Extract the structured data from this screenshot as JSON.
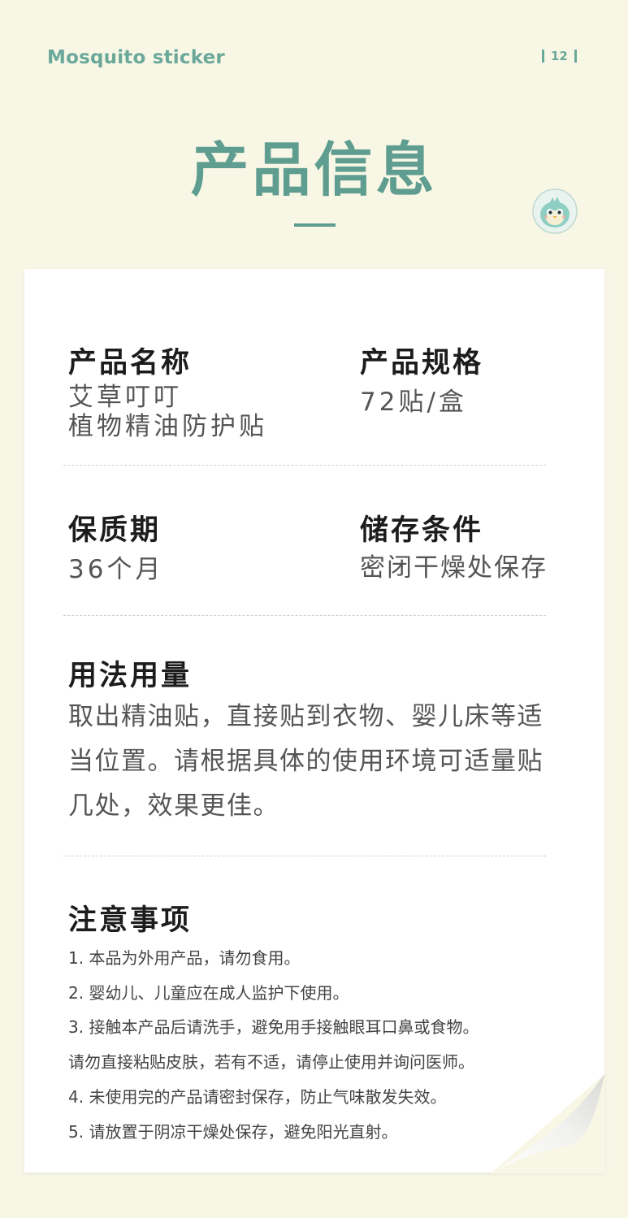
{
  "header": {
    "brand": "Mosquito sticker",
    "page_number": "12"
  },
  "title": "产品信息",
  "fields": {
    "name": {
      "label": "产品名称",
      "value_line1": "艾草叮叮",
      "value_line2": "植物精油防护贴"
    },
    "spec": {
      "label": "产品规格",
      "value": "72贴/盒"
    },
    "shelf_life": {
      "label": "保质期",
      "value": "36个月"
    },
    "storage": {
      "label": "储存条件",
      "value": "密闭干燥处保存"
    },
    "usage": {
      "label": "用法用量",
      "value": "取出精油贴，直接贴到衣物、婴儿床等适当位置。请根据具体的使用环境可适量贴几处，效果更佳。"
    },
    "notes": {
      "label": "注意事项",
      "items": [
        "1. 本品为外用产品，请勿食用。",
        "2. 婴幼儿、儿童应在成人监护下使用。",
        "3. 接触本产品后请洗手，避免用手接触眼耳口鼻或食物。",
        "请勿直接粘贴皮肤，若有不适，请停止使用并询问医师。",
        "4. 未使用完的产品请密封保存，防止气味散发失效。",
        "5. 请放置于阴凉干燥处保存，避免阳光直射。"
      ]
    }
  },
  "colors": {
    "background": "#f8f7e6",
    "accent": "#5e9d8f",
    "card": "#ffffff"
  },
  "icons": [
    "mascot-bird-icon",
    "page-curl-decoration"
  ]
}
